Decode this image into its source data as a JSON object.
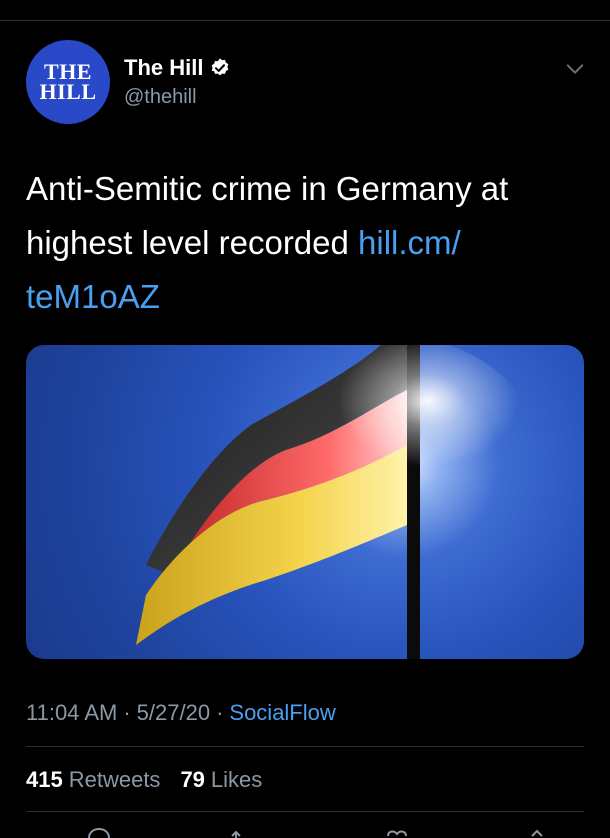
{
  "author": {
    "avatar_line1": "THE",
    "avatar_line2": "HILL",
    "display_name": "The Hill",
    "handle": "@thehill",
    "verified": true
  },
  "tweet": {
    "text": "Anti-Semitic crime in Germany at highest level recorded ",
    "link": "hill.cm/teM1oAZ",
    "link_display_line1": "hill.cm/",
    "link_display_line2": "teM1oAZ"
  },
  "media": {
    "description_icon": "german-flag-image"
  },
  "meta": {
    "time": "11:04 AM",
    "separator": "·",
    "date": "5/27/20",
    "source": "SocialFlow"
  },
  "stats": {
    "retweets_count": "415",
    "retweets_label": "Retweets",
    "likes_count": "79",
    "likes_label": "Likes"
  },
  "actions": [
    "reply-icon",
    "retweet-icon",
    "like-icon",
    "share-icon"
  ],
  "colors": {
    "background": "#000000",
    "link": "#4a9ff0",
    "secondary_text": "#8b98a5",
    "avatar_bg": "#2a49c8"
  }
}
